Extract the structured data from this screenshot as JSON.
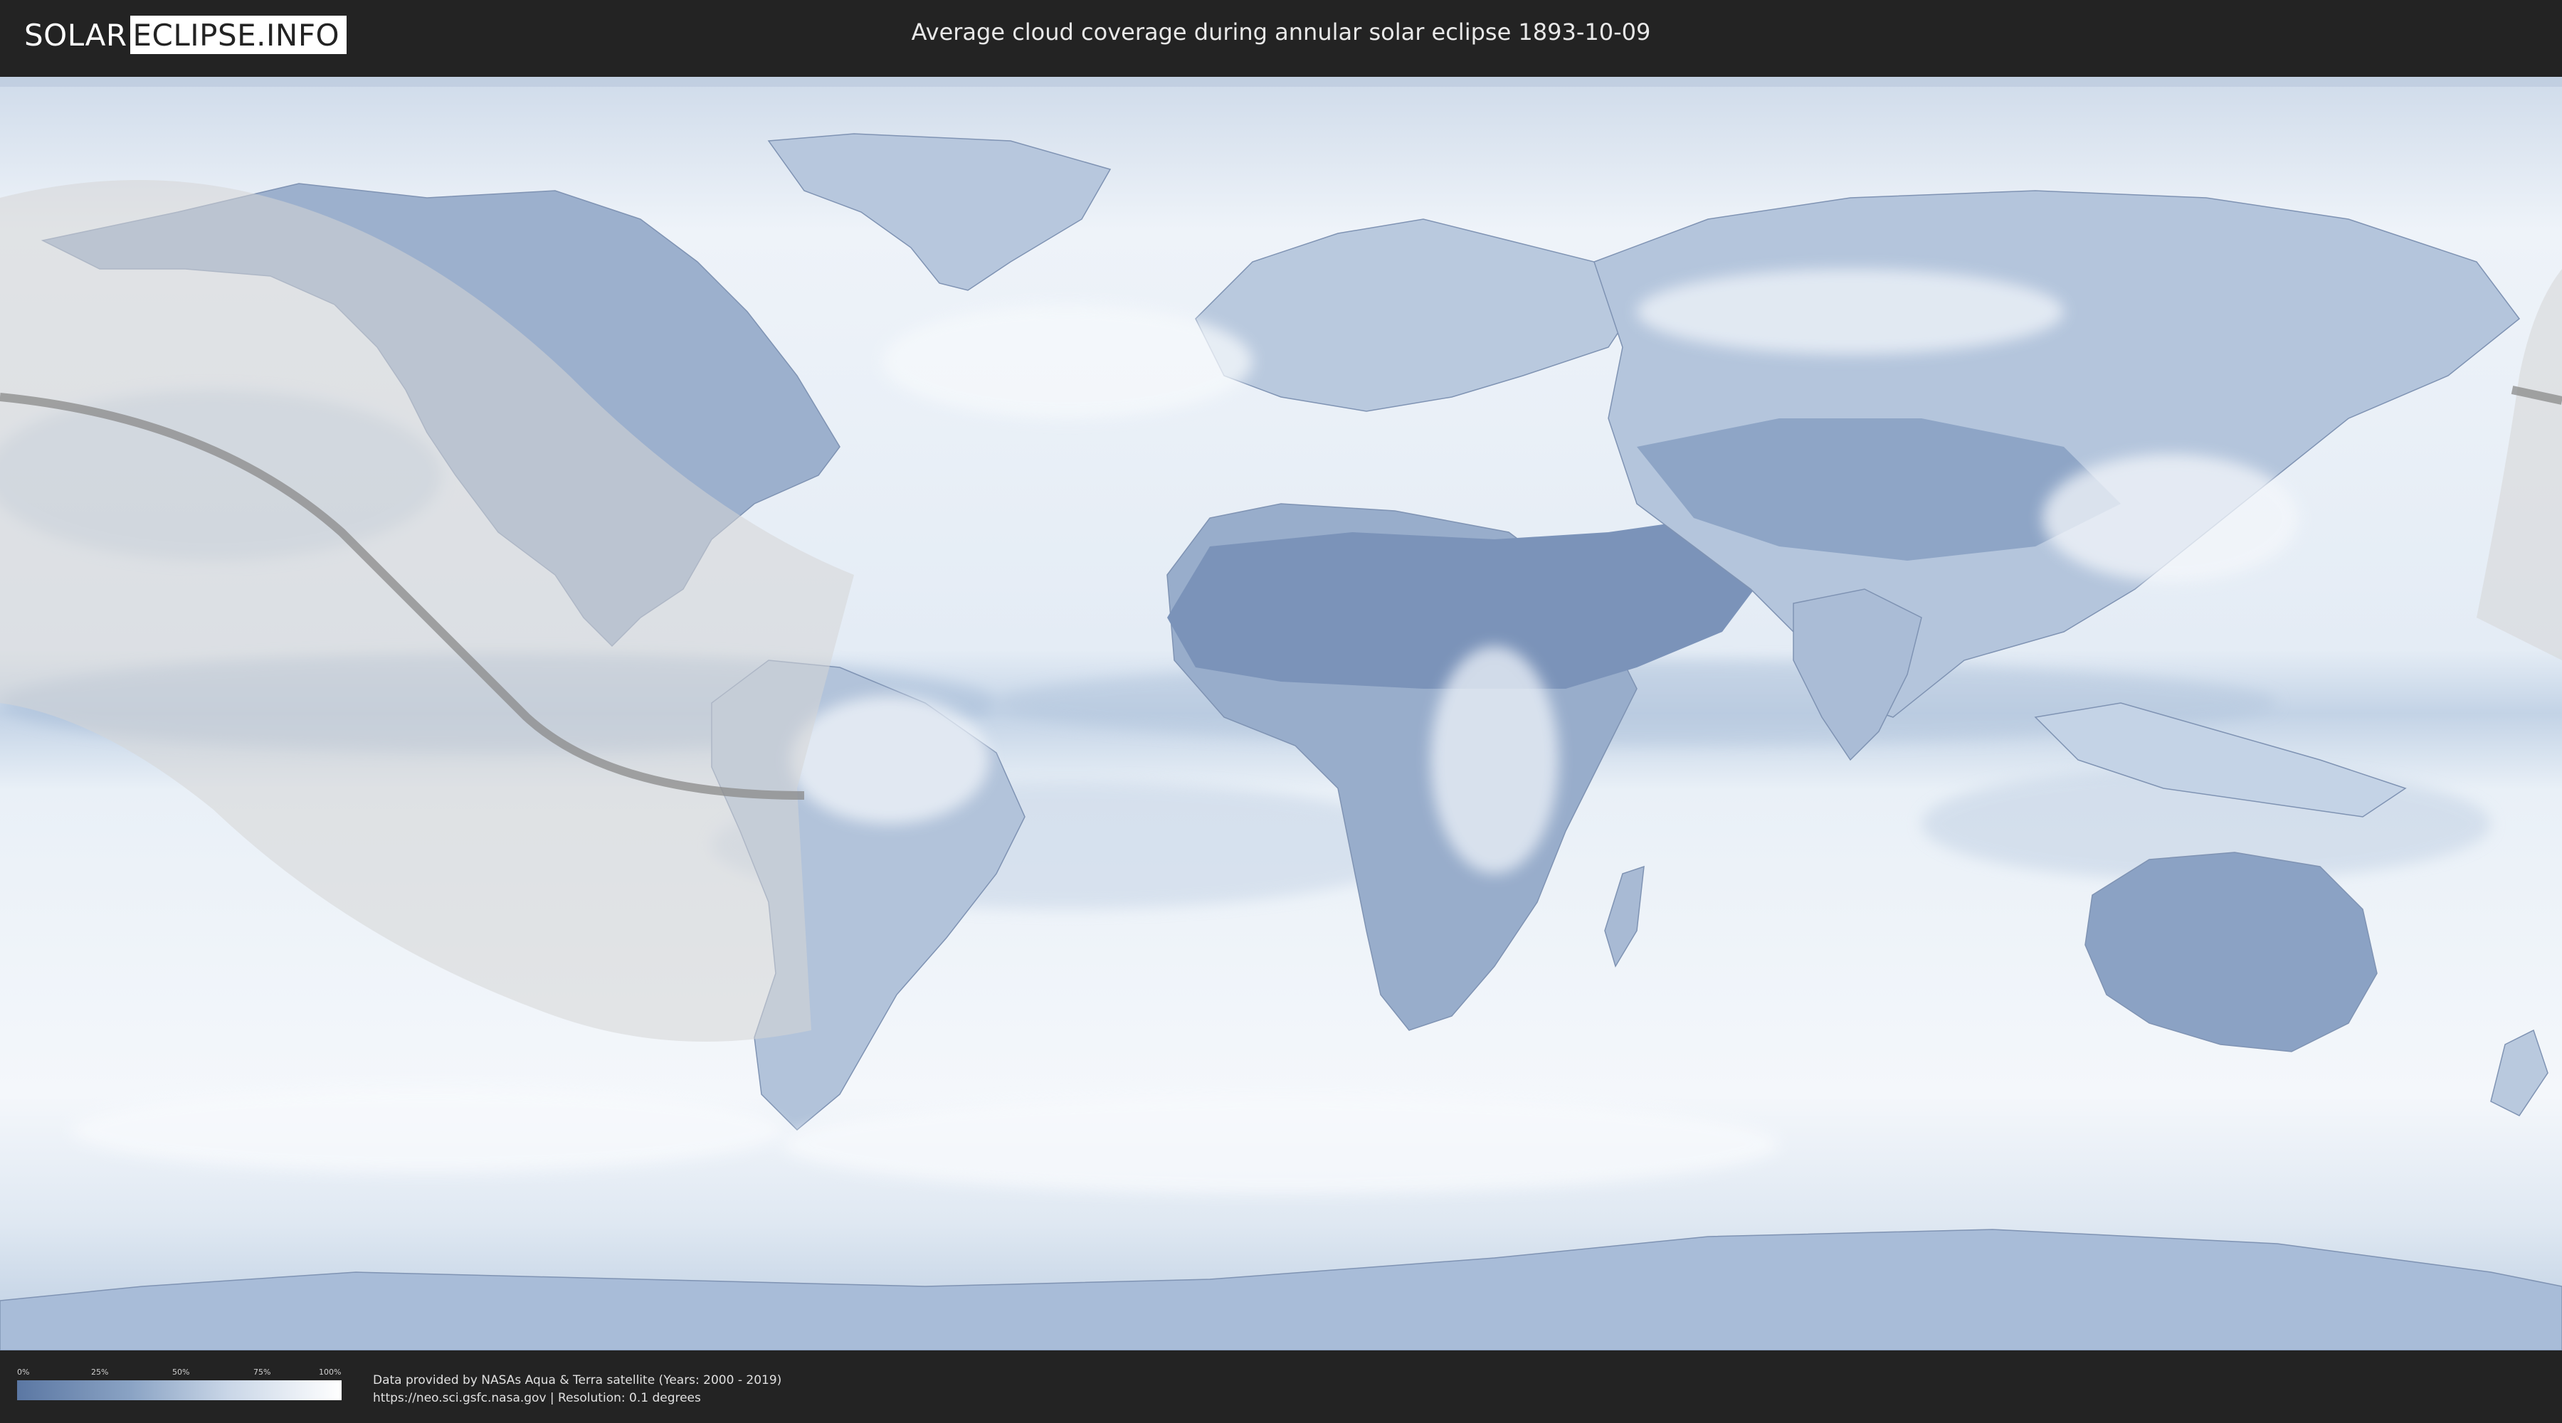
{
  "header": {
    "logo_left": "SOLAR",
    "logo_right": "ECLIPSE.INFO",
    "title": "Average cloud coverage during annular solar eclipse 1893-10-09"
  },
  "legend": {
    "ticks": [
      "0%",
      "25%",
      "50%",
      "75%",
      "100%"
    ],
    "low_color": "#5b77a3",
    "high_color": "#ffffff"
  },
  "footer": {
    "line1": "Data provided by NASAs Aqua & Terra satellite (Years: 2000 - 2019)",
    "line2": "https://neo.sci.gsfc.nasa.gov | Resolution: 0.1 degrees"
  },
  "colors": {
    "background": "#232323",
    "ocean_light": "#e6edf6",
    "cloud_dense": "#ffffff",
    "clear_sky": "#6b86b0",
    "eclipse_zone": "#cfcfcf",
    "central_line": "#8a8a8a"
  }
}
